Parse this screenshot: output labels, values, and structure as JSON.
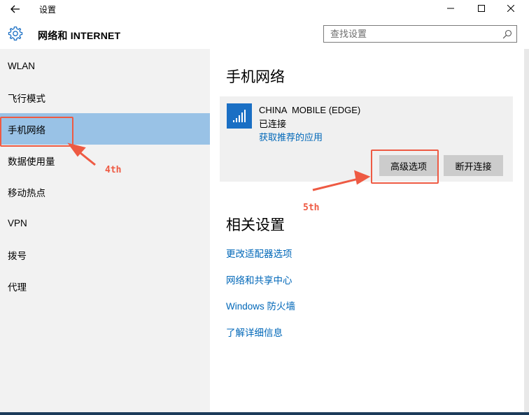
{
  "window": {
    "title": "设置",
    "minimize_glyph": "—",
    "maximize_glyph": "☐",
    "close_glyph": "✕"
  },
  "header": {
    "section_title": "网络和 INTERNET",
    "search_placeholder": "查找设置"
  },
  "sidebar": {
    "selected": "手机网络",
    "items": [
      {
        "label": "WLAN"
      },
      {
        "label": "飞行模式"
      },
      {
        "label": "手机网络"
      },
      {
        "label": "数据使用量"
      },
      {
        "label": "移动热点"
      },
      {
        "label": "VPN"
      },
      {
        "label": "拨号"
      },
      {
        "label": "代理"
      }
    ]
  },
  "main": {
    "title": "手机网络",
    "network": {
      "name": "CHINA  MOBILE (EDGE)",
      "status": "已连接",
      "app_link": "获取推荐的应用",
      "advanced_button": "高级选项",
      "disconnect_button": "断开连接"
    },
    "related": {
      "title": "相关设置",
      "links": [
        {
          "label": "更改适配器选项"
        },
        {
          "label": "网络和共享中心"
        },
        {
          "label": "Windows 防火墙"
        },
        {
          "label": "了解详细信息"
        }
      ]
    }
  },
  "annotations": {
    "step4": "4th",
    "step5": "5th",
    "color": "#ee5a43"
  },
  "colors": {
    "accent": "#1a6fc4",
    "link": "#0067b8",
    "selected_bg": "#99c2e6",
    "sidebar_bg": "#f2f2f2"
  },
  "icons": {
    "back": "arrow-left-icon",
    "settings": "gear-icon",
    "search": "search-icon",
    "signal": "cellular-signal-icon"
  }
}
